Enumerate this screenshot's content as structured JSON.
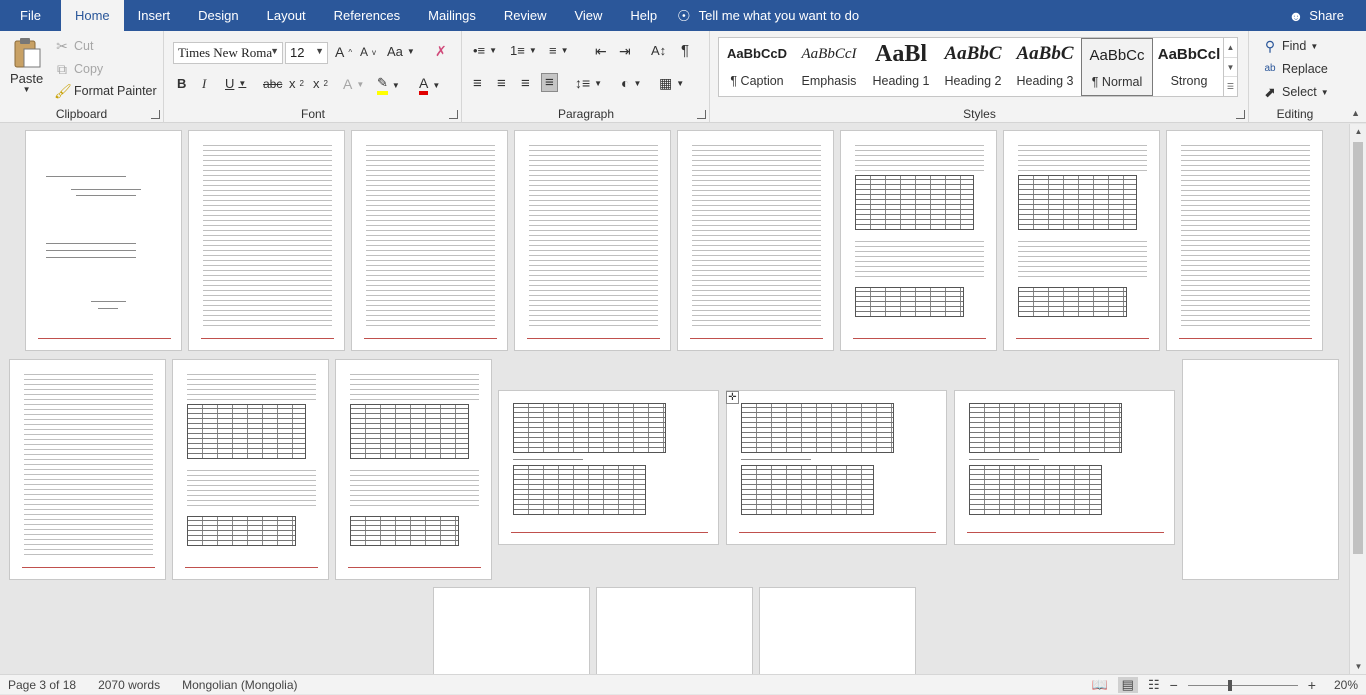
{
  "tabs": [
    "File",
    "Home",
    "Insert",
    "Design",
    "Layout",
    "References",
    "Mailings",
    "Review",
    "View",
    "Help"
  ],
  "active_tab": "Home",
  "tell_me": "Tell me what you want to do",
  "share": "Share",
  "clipboard": {
    "paste": "Paste",
    "cut": "Cut",
    "copy": "Copy",
    "format_painter": "Format Painter",
    "label": "Clipboard"
  },
  "font": {
    "name": "Times New Roma",
    "size": "12",
    "label": "Font"
  },
  "paragraph": {
    "label": "Paragraph"
  },
  "styles": {
    "label": "Styles",
    "items": [
      {
        "preview": "AaBbCcD",
        "name": "¶ Caption"
      },
      {
        "preview": "AaBbCcI",
        "name": "Emphasis"
      },
      {
        "preview": "AaBl",
        "name": "Heading 1"
      },
      {
        "preview": "AaBbC",
        "name": "Heading 2"
      },
      {
        "preview": "AaBbC",
        "name": "Heading 3"
      },
      {
        "preview": "AaBbCc",
        "name": "¶ Normal"
      },
      {
        "preview": "AaBbCcl",
        "name": "Strong"
      }
    ]
  },
  "editing": {
    "find": "Find",
    "replace": "Replace",
    "select": "Select",
    "label": "Editing"
  },
  "status": {
    "page": "Page 3 of 18",
    "words": "2070 words",
    "language": "Mongolian (Mongolia)",
    "zoom": "20%"
  }
}
